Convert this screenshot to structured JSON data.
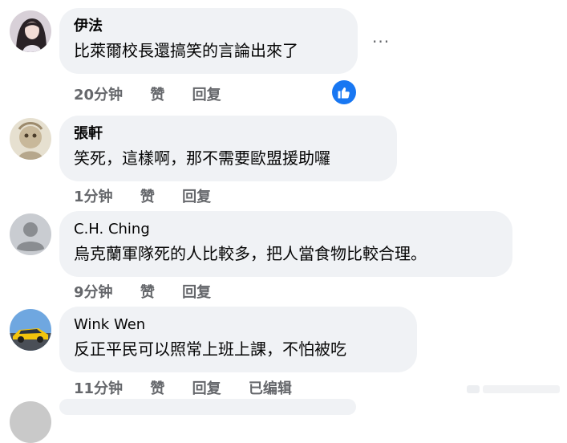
{
  "comments": [
    {
      "author": "伊法",
      "text": "比萊爾校長還搞笑的言論出來了",
      "time": "20分钟",
      "like_label": "赞",
      "reply_label": "回复",
      "edited_label": "",
      "has_like_reaction": true,
      "has_more_menu": true,
      "more_label": "···",
      "avatar_icon": "avatar-photo-woman"
    },
    {
      "author": "張軒",
      "text": "笑死，這樣啊，那不需要歐盟援助囉",
      "time": "1分钟",
      "like_label": "赞",
      "reply_label": "回复",
      "edited_label": "",
      "avatar_icon": "avatar-photo-illustration"
    },
    {
      "author": "C.H. Ching",
      "text": "烏克蘭軍隊死的人比較多，把人當食物比較合理。",
      "time": "9分钟",
      "like_label": "赞",
      "reply_label": "回复",
      "edited_label": "",
      "avatar_icon": "default-profile-icon"
    },
    {
      "author": "Wink Wen",
      "text": "反正平民可以照常上班上課，不怕被吃",
      "time": "11分钟",
      "like_label": "赞",
      "reply_label": "回复",
      "edited_label": "已编辑",
      "avatar_icon": "avatar-photo-car"
    }
  ],
  "colors": {
    "bubble_bg": "#f0f2f5",
    "meta_text": "#65676b",
    "like_blue": "#1877f2"
  }
}
